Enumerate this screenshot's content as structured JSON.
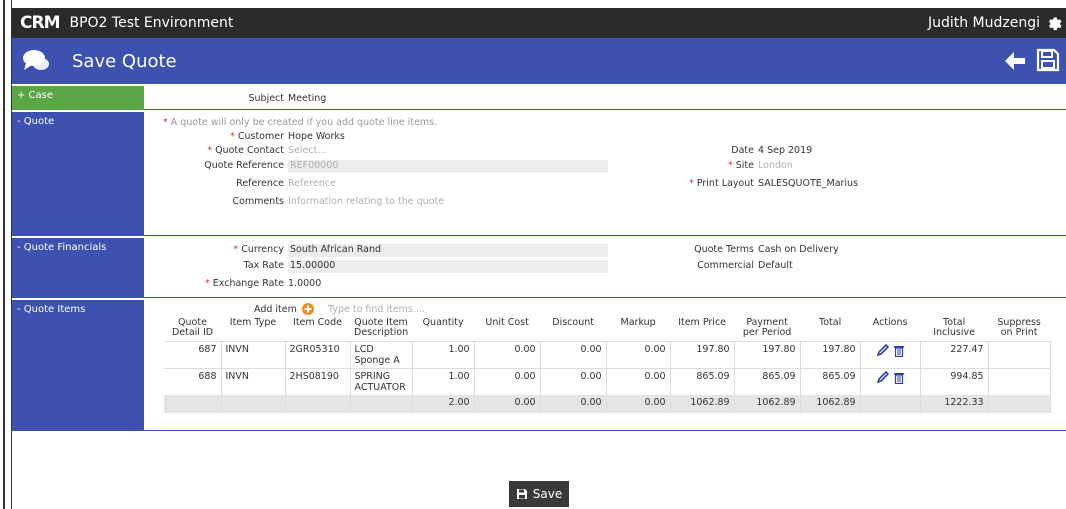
{
  "topbar": {
    "logo": "CRM",
    "env": "BPO2 Test Environment",
    "user": "Judith Mudzengi"
  },
  "titlebar": {
    "title": "Save Quote"
  },
  "sections": {
    "case": {
      "label": "+ Case",
      "subject_label": "Subject",
      "subject_value": "Meeting"
    },
    "quote": {
      "label": "- Quote",
      "note": "A quote will only be created if you add quote line items.",
      "customer_label": "Customer",
      "customer_value": "Hope Works",
      "contact_label": "Quote Contact",
      "contact_placeholder": "Select...",
      "qref_label": "Quote Reference",
      "qref_placeholder": "REF00000",
      "ref_label": "Reference",
      "ref_placeholder": "Reference",
      "comments_label": "Comments",
      "comments_placeholder": "Information relating to the quote",
      "date_label": "Date",
      "date_value": "4 Sep 2019",
      "site_label": "Site",
      "site_value": "London",
      "layout_label": "Print Layout",
      "layout_value": "SALESQUOTE_Marius"
    },
    "financials": {
      "label": "- Quote Financials",
      "currency_label": "Currency",
      "currency_value": "South African Rand",
      "tax_label": "Tax Rate",
      "tax_value": "15.00000",
      "exch_label": "Exchange Rate",
      "exch_value": "1.0000",
      "terms_label": "Quote Terms",
      "terms_value": "Cash on Delivery",
      "commercial_label": "Commercial",
      "commercial_value": "Default"
    },
    "items": {
      "label": "- Quote Items",
      "add_label": "Add item",
      "add_placeholder": "Type to find items....",
      "headers": [
        "Quote Detail ID",
        "Item Type",
        "Item Code",
        "Quote Item Description",
        "Quantity",
        "Unit Cost",
        "Discount",
        "Markup",
        "Item Price",
        "Payment per Period",
        "Total",
        "Actions",
        "Total Inclusive",
        "Suppress on Print"
      ],
      "rows": [
        [
          "687",
          "INVN",
          "2GR05310",
          "LCD Sponge A",
          "1.00",
          "0.00",
          "0.00",
          "0.00",
          "197.80",
          "197.80",
          "197.80",
          "",
          "227.47",
          ""
        ],
        [
          "688",
          "INVN",
          "2HS08190",
          "SPRING ACTUATOR",
          "1.00",
          "0.00",
          "0.00",
          "0.00",
          "865.09",
          "865.09",
          "865.09",
          "",
          "994.85",
          ""
        ]
      ],
      "totals": [
        "",
        "",
        "",
        "",
        "2.00",
        "0.00",
        "0.00",
        "0.00",
        "1062.89",
        "1062.89",
        "1062.89",
        "",
        "1222.33",
        ""
      ]
    }
  },
  "save_button": "Save",
  "required_mark": "*",
  "colors": {
    "header_dark": "#2b2b2b",
    "brand_blue": "#3d51b0",
    "case_green": "#5aa545",
    "required_red": "#d9342b"
  }
}
